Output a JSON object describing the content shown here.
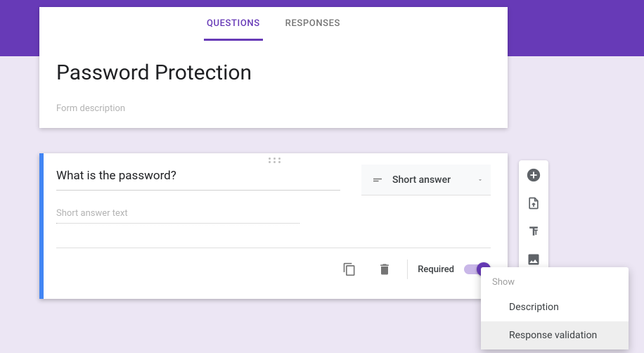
{
  "tabs": {
    "questions": "QUESTIONS",
    "responses": "RESPONSES"
  },
  "form": {
    "title": "Password Protection",
    "description_placeholder": "Form description"
  },
  "question": {
    "title": "What is the password?",
    "answer_placeholder": "Short answer text",
    "type_label": "Short answer",
    "required_label": "Required"
  },
  "popup": {
    "header": "Show",
    "items": {
      "description": "Description",
      "response_validation": "Response validation"
    }
  }
}
